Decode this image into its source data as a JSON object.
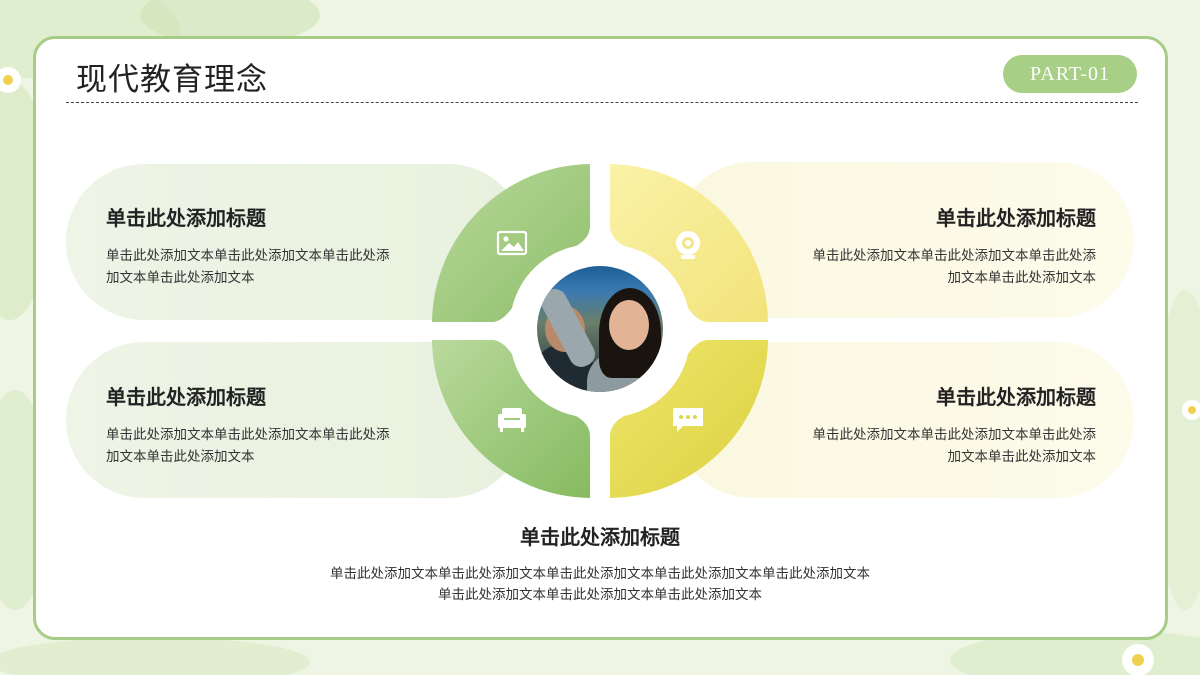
{
  "header": {
    "title": "现代教育理念",
    "badge": "PART-01"
  },
  "items": [
    {
      "title": "单击此处添加标题",
      "line1": "单击此处添加文本单击此处添加文本单击此处添",
      "line2": "加文本单击此处添加文本",
      "icon": "image-icon"
    },
    {
      "title": "单击此处添加标题",
      "line1": "单击此处添加文本单击此处添加文本单击此处添",
      "line2": "加文本单击此处添加文本",
      "icon": "camera-icon"
    },
    {
      "title": "单击此处添加标题",
      "line1": "单击此处添加文本单击此处添加文本单击此处添",
      "line2": "加文本单击此处添加文本",
      "icon": "sofa-icon"
    },
    {
      "title": "单击此处添加标题",
      "line1": "单击此处添加文本单击此处添加文本单击此处添",
      "line2": "加文本单击此处添加文本",
      "icon": "chat-icon"
    }
  ],
  "bottom": {
    "title": "单击此处添加标题",
    "line1": "单击此处添加文本单击此处添加文本单击此处添加文本单击此处添加文本单击此处添加文本",
    "line2": "单击此处添加文本单击此处添加文本单击此处添加文本"
  },
  "colors": {
    "accent_green": "#a8cf86",
    "accent_yellow": "#e6dc52"
  }
}
